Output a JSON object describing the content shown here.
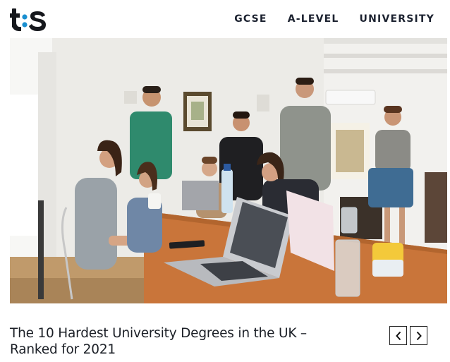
{
  "brand": {
    "logo_text": "ts",
    "accent": "#1a8fd0"
  },
  "nav": {
    "items": [
      {
        "label": "GCSE"
      },
      {
        "label": "A-LEVEL"
      },
      {
        "label": "UNIVERSITY"
      }
    ]
  },
  "hero": {
    "image": "students-around-table-with-laptops"
  },
  "article": {
    "title": "The 10 Hardest University Degrees in the UK – Ranked for 2021"
  },
  "carousel": {
    "prev_icon": "chevron-left-icon",
    "next_icon": "chevron-right-icon"
  }
}
